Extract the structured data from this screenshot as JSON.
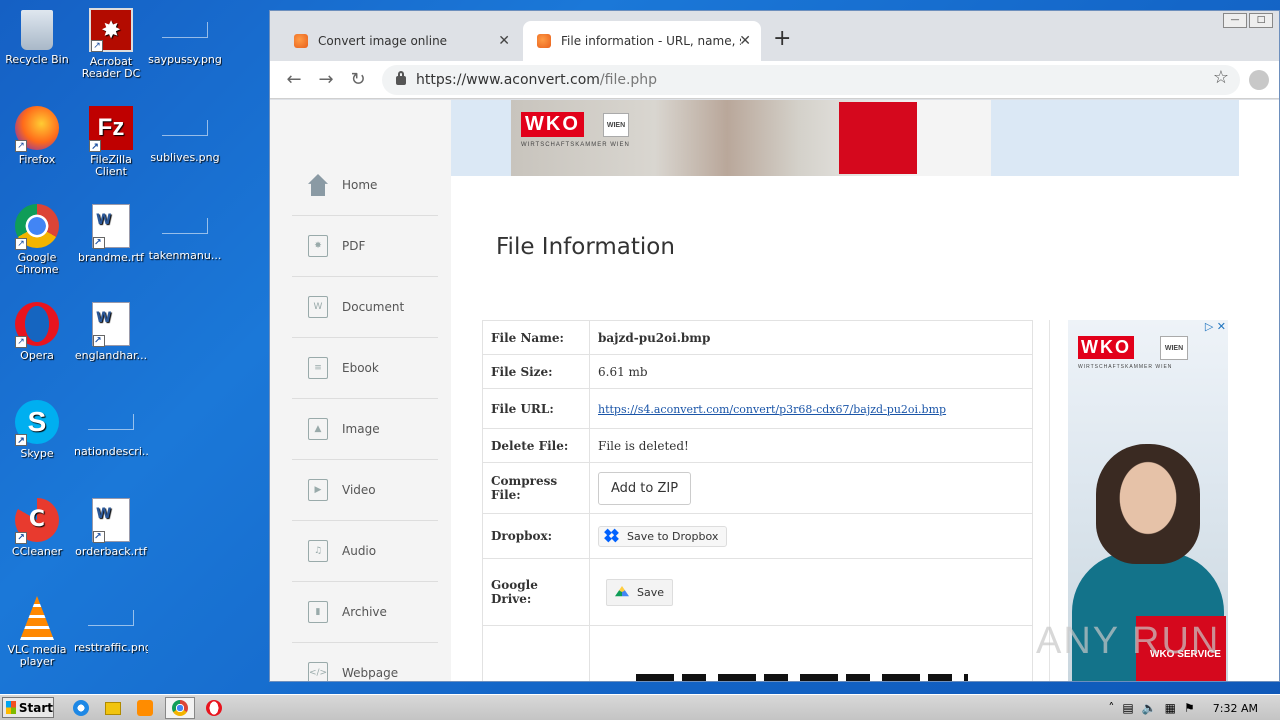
{
  "desktop": {
    "icons": [
      {
        "label": "Recycle Bin"
      },
      {
        "label": "Acrobat Reader DC"
      },
      {
        "label": "saypussy.png"
      },
      {
        "label": "Firefox"
      },
      {
        "label": "FileZilla Client"
      },
      {
        "label": "sublives.png"
      },
      {
        "label": "Google Chrome"
      },
      {
        "label": "brandme.rtf"
      },
      {
        "label": "takenmanu..."
      },
      {
        "label": "Opera"
      },
      {
        "label": "englandhar..."
      },
      {
        "label": "Skype"
      },
      {
        "label": "nationdescri..."
      },
      {
        "label": "CCleaner"
      },
      {
        "label": "orderback.rtf"
      },
      {
        "label": "VLC media player"
      },
      {
        "label": "resttraffic.png"
      }
    ]
  },
  "browser": {
    "tabs": [
      {
        "title": "Convert image online",
        "close": "✕"
      },
      {
        "title": "File information - URL, name, size an",
        "close": "✕"
      }
    ],
    "new_tab": "+",
    "url_host": "https://www.aconvert.com",
    "url_path": "/file.php",
    "nav": {
      "back": "←",
      "forward": "→",
      "reload": "↻",
      "star": "☆"
    }
  },
  "sidebar": {
    "items": [
      {
        "label": "Home",
        "icon": "home-icon"
      },
      {
        "label": "PDF",
        "icon": "pdf-icon"
      },
      {
        "label": "Document",
        "icon": "document-icon"
      },
      {
        "label": "Ebook",
        "icon": "ebook-icon"
      },
      {
        "label": "Image",
        "icon": "image-icon"
      },
      {
        "label": "Video",
        "icon": "video-icon"
      },
      {
        "label": "Audio",
        "icon": "audio-icon"
      },
      {
        "label": "Archive",
        "icon": "archive-icon"
      },
      {
        "label": "Webpage",
        "icon": "webpage-icon"
      }
    ]
  },
  "banner": {
    "logo": "WKO",
    "wien": "WIEN",
    "sub": "WIRTSCHAFTSKAMMER WIEN"
  },
  "main": {
    "title": "File Information",
    "rows": [
      {
        "key": "File Name:",
        "value": "bajzd-pu2oi.bmp"
      },
      {
        "key": "File Size:",
        "value": "6.61 mb"
      },
      {
        "key": "File URL:",
        "value": "https://s4.aconvert.com/convert/p3r68-cdx67/bajzd-pu2oi.bmp"
      },
      {
        "key": "Delete File:",
        "value": "File is deleted!"
      },
      {
        "key": "Compress File:",
        "value": "Add to ZIP"
      },
      {
        "key": "Dropbox:",
        "value": "Save to Dropbox"
      },
      {
        "key": "Google Drive:",
        "value": "Save"
      }
    ]
  },
  "ad": {
    "logo": "WKO",
    "wien": "WIEN",
    "sub": "WIRTSCHAFTSKAMMER WIEN",
    "service": "WKO SERVICE",
    "close": "▷ ✕"
  },
  "watermark": "ANY RUN",
  "taskbar": {
    "start": "Start",
    "clock": "7:32 AM"
  },
  "colors": {
    "accent": "#1a55a8",
    "wko_red": "#e2001a",
    "desktop_blue": "#1560c4"
  }
}
